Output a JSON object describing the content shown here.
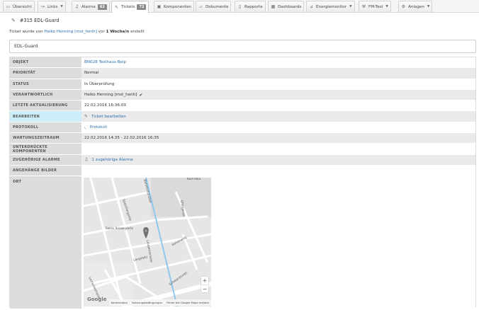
{
  "nav": {
    "tabs": [
      {
        "label": "Übersicht",
        "icon": "monitor-icon"
      },
      {
        "label": "Links",
        "icon": "share-icon",
        "dropdown": true
      },
      {
        "label": "Alarme",
        "icon": "bell-icon",
        "badge": "62"
      },
      {
        "label": "Tickets",
        "icon": "ticket-icon",
        "badge": "72",
        "active": true
      },
      {
        "label": "Komponenten",
        "icon": "component-icon"
      },
      {
        "label": "Dokumente",
        "icon": "folder-icon"
      },
      {
        "label": "Rapporte",
        "icon": "document-icon"
      },
      {
        "label": "Dashboards",
        "icon": "dashboard-icon"
      },
      {
        "label": "Energiemonitor",
        "icon": "chart-icon",
        "dropdown": true
      },
      {
        "label": "FM-Tool",
        "icon": "wrench-icon",
        "dropdown": true
      },
      {
        "label": "Anlagen",
        "icon": "plant-icon",
        "dropdown": true
      }
    ]
  },
  "ticket": {
    "title": "#315 EDL-Guard",
    "created_prefix": "Ticket wurde von",
    "created_by": "Heiko Henning [mst_henh]",
    "created_mid": "vor",
    "created_age": "1 Woche/n",
    "created_suffix": "erstellt",
    "name": "EDL-Guard"
  },
  "details": [
    {
      "label": "OBJEKT",
      "value": "BN028 Testhaus Belp",
      "link": true
    },
    {
      "label": "PRIORITÄT",
      "value": "Normal"
    },
    {
      "label": "STATUS",
      "value": "In Überprüfung"
    },
    {
      "label": "VERANTWORTLICH",
      "value": "Heiko Henning [mst_henh]",
      "check": "✔"
    },
    {
      "label": "LETZTE AKTUALISIERUNG",
      "value": "22.02.2016 16:36:03"
    },
    {
      "label": "BEARBEITEN",
      "value": "Ticket bearbeiten",
      "link": true,
      "icon": "edit-icon",
      "highlight": true
    },
    {
      "label": "PROTOKOLL",
      "value": "Protokoll",
      "link": true,
      "icon": "log-icon"
    },
    {
      "label": "WARTUNGSZEITRAUM",
      "value": "22.02.2016 14:35 - 22.02.2016 16:35"
    },
    {
      "label": "UNTERDRÜCKTE KOMPONENTEN",
      "value": ""
    },
    {
      "label": "ZUGEHÖRIGE ALARME",
      "value": "1 zugehörige Alarme",
      "link": true,
      "icon": "bell-icon"
    },
    {
      "label": "ANGEHÄNGE BILDER",
      "value": ""
    }
  ],
  "ort": {
    "label": "ORT",
    "map": {
      "labels": {
        "karl": "Karl-Pala",
        "swiss": "Swiss Snowsports",
        "street1": "Speichergasse",
        "street2": "Laupenstrasse",
        "street3": "Loryplatz",
        "street4": "Hohenweg",
        "street5": "Schwarztorstr.",
        "street6": "Bahnhofstrasse",
        "street7": "Effingerstr.",
        "street8": "Lorrainestrasse",
        "logo": "Google"
      },
      "zoom_in": "+",
      "zoom_out": "−",
      "attribution": [
        "Kartendaten",
        "Nutzungsbedingungen",
        "Fehler bei Google Maps melden"
      ]
    }
  }
}
